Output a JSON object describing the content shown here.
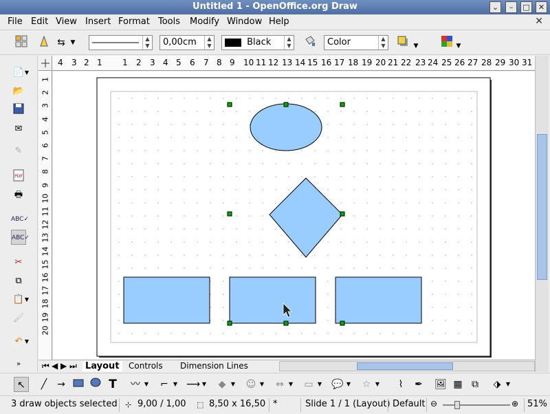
{
  "window": {
    "title": "Untitled 1 - OpenOffice.org Draw"
  },
  "menu": [
    "File",
    "Edit",
    "View",
    "Insert",
    "Format",
    "Tools",
    "Modify",
    "Window",
    "Help"
  ],
  "toolbar": {
    "line_width": "0,00cm",
    "line_color": "Black",
    "area_style": "Color"
  },
  "ruler": {
    "h": [
      "4",
      "3",
      "2",
      "1",
      "1",
      "2",
      "3",
      "4",
      "5",
      "6",
      "7",
      "8",
      "9",
      "10",
      "11",
      "12",
      "13",
      "14",
      "15",
      "16",
      "17",
      "18",
      "19",
      "20",
      "21",
      "22",
      "23",
      "24",
      "25",
      "26",
      "27",
      "28",
      "29",
      "30",
      "31"
    ],
    "v": [
      "1",
      "2",
      "3",
      "4",
      "5",
      "6",
      "7",
      "8",
      "9",
      "10",
      "11",
      "12",
      "13",
      "14",
      "15",
      "16",
      "17",
      "18",
      "19",
      "20"
    ]
  },
  "tabs": [
    "Layout",
    "Controls",
    "Dimension Lines"
  ],
  "status": {
    "selection": "3 draw objects selected",
    "position": "9,00 / 1,00",
    "size": "8,50 x 16,50",
    "modified": "*",
    "slide": "Slide 1 / 1 (Layout)",
    "layout": "Default",
    "zoom": "51%"
  },
  "colors": {
    "shape_fill": "#99ccff",
    "handle": "#00aa00",
    "title_bar": "#4f6fa3",
    "scroll_thumb": "#a9c4e8"
  }
}
